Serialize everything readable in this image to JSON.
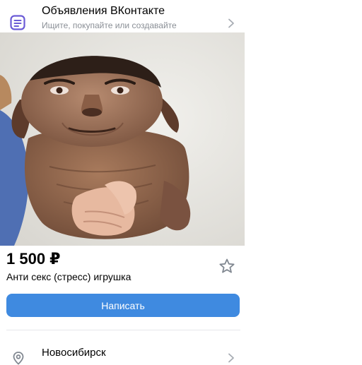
{
  "header": {
    "title": "Объявления ВКонтакте",
    "subtitle": "Ищите, покупайте или создавайте",
    "app_icon": "classifieds-icon",
    "chevron_icon": "chevron-right-icon"
  },
  "listing": {
    "image_description": "dog-photo",
    "price": "1 500 ₽",
    "title": "Анти секс (стресс) игрушка",
    "favorite_icon": "star-icon",
    "write_button_label": "Написать"
  },
  "location": {
    "city": "Новосибирск",
    "icon": "location-pin-icon",
    "chevron_icon": "chevron-right-icon"
  },
  "colors": {
    "accent": "#3f8ae0",
    "icon_purple": "#6b5bd6",
    "subtitle_gray": "#8a8f96",
    "divider": "#e6e7ea"
  }
}
